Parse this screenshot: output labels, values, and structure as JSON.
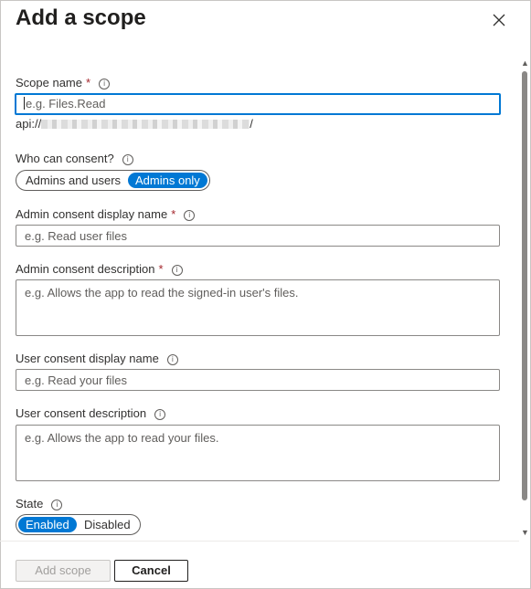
{
  "panel": {
    "title": "Add a scope",
    "close_icon": "close-icon"
  },
  "form": {
    "scope_name": {
      "label": "Scope name",
      "required": "*",
      "placeholder": "e.g. Files.Read"
    },
    "api_prefix": "api://",
    "api_suffix": "/",
    "who_can_consent": {
      "label": "Who can consent?",
      "options": [
        "Admins and users",
        "Admins only"
      ],
      "selected": "Admins only"
    },
    "admin_display_name": {
      "label": "Admin consent display name",
      "required": "*",
      "placeholder": "e.g. Read user files"
    },
    "admin_description": {
      "label": "Admin consent description",
      "required": "*",
      "placeholder": "e.g. Allows the app to read the signed-in user's files."
    },
    "user_display_name": {
      "label": "User consent display name",
      "placeholder": "e.g. Read your files"
    },
    "user_description": {
      "label": "User consent description",
      "placeholder": "e.g. Allows the app to read your files."
    },
    "state": {
      "label": "State",
      "options": [
        "Enabled",
        "Disabled"
      ],
      "selected": "Enabled"
    }
  },
  "footer": {
    "add_label": "Add scope",
    "cancel_label": "Cancel"
  },
  "colors": {
    "accent": "#0078d4",
    "required": "#a4262c"
  }
}
